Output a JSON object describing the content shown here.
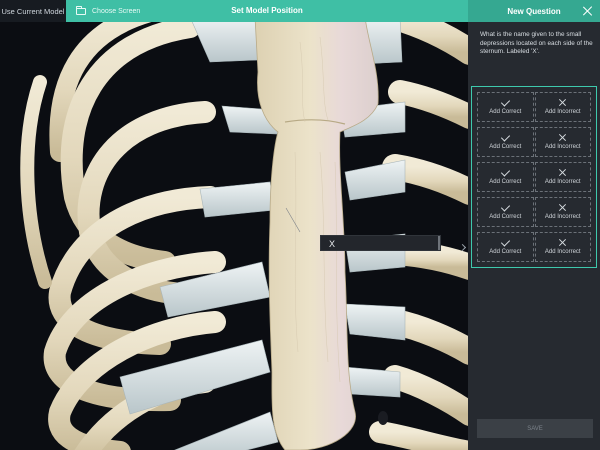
{
  "topbar": {
    "use_model_label": "Use Current Model",
    "choose_screen_label": "Choose Screen",
    "title": "Set Model Position"
  },
  "panel": {
    "title": "New Question",
    "question": "What is the name given to the small depressions located on each side of the sternum. Labeled 'X'.",
    "answers": [
      {
        "correct_label": "Add Correct",
        "incorrect_label": "Add Incorrect"
      },
      {
        "correct_label": "Add Correct",
        "incorrect_label": "Add Incorrect"
      },
      {
        "correct_label": "Add Correct",
        "incorrect_label": "Add Incorrect"
      },
      {
        "correct_label": "Add Correct",
        "incorrect_label": "Add Incorrect"
      },
      {
        "correct_label": "Add Correct",
        "incorrect_label": "Add Incorrect"
      }
    ],
    "save_label": "SAVE"
  },
  "viewport": {
    "label_text": "X"
  },
  "colors": {
    "accent": "#3fbfa5",
    "accent_dark": "#35a891",
    "panel_bg": "#262a30",
    "bone": "#e8dfc6",
    "cartilage": "#d8e2e5"
  }
}
